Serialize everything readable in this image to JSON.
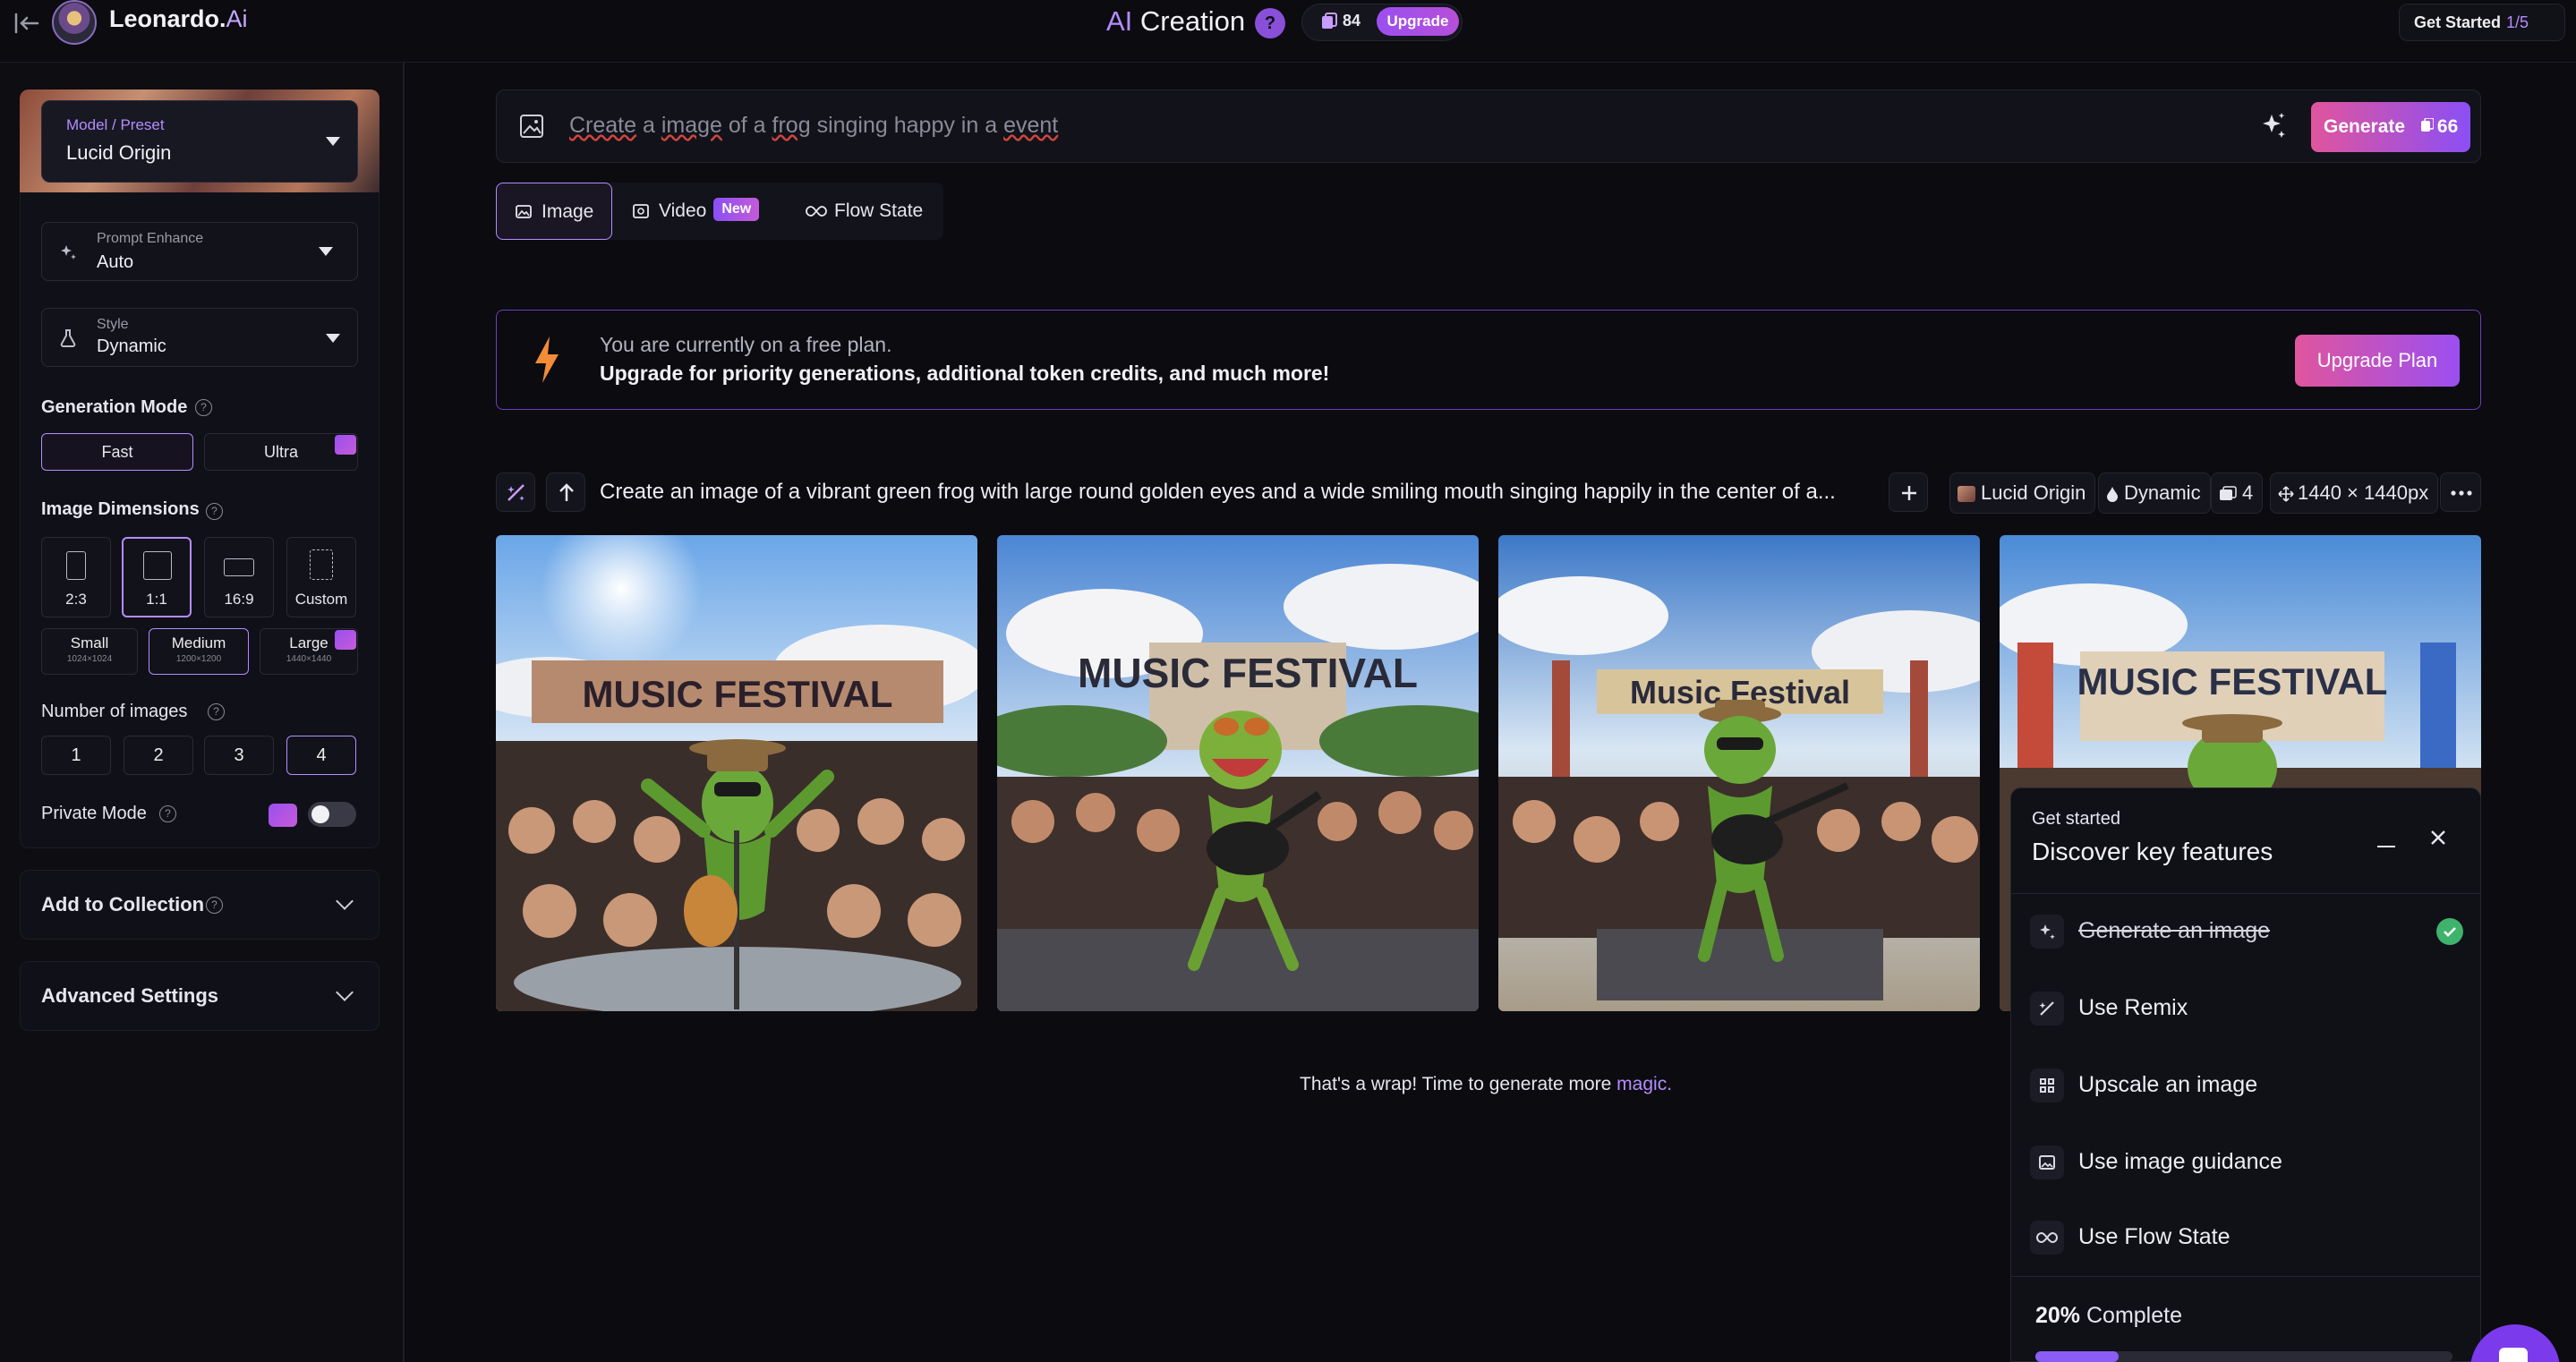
{
  "topbar": {
    "brand_name": "Leonardo.",
    "brand_suffix": "Ai",
    "title_prefix": "AI",
    "title_main": " Creation",
    "help_label": "?",
    "token_count": "84",
    "upgrade_label": "Upgrade",
    "get_started_label": "Get Started",
    "get_started_progress": "1/5"
  },
  "sidebar": {
    "model_label": "Model / Preset",
    "model_value": "Lucid Origin",
    "prompt_enhance_label": "Prompt Enhance",
    "prompt_enhance_value": "Auto",
    "style_label": "Style",
    "style_value": "Dynamic",
    "generation_mode_title": "Generation Mode",
    "generation_modes": [
      "Fast",
      "Ultra"
    ],
    "image_dimensions_title": "Image Dimensions",
    "aspect_ratios": [
      "2:3",
      "1:1",
      "16:9",
      "Custom"
    ],
    "sizes": [
      {
        "name": "Small",
        "dims": "1024×1024"
      },
      {
        "name": "Medium",
        "dims": "1200×1200"
      },
      {
        "name": "Large",
        "dims": "1440×1440"
      }
    ],
    "number_of_images_title": "Number of images",
    "image_counts": [
      "1",
      "2",
      "3",
      "4"
    ],
    "private_mode_label": "Private Mode",
    "add_to_collection_label": "Add to Collection",
    "advanced_settings_label": "Advanced Settings"
  },
  "prompt": {
    "placeholder_parts": [
      "Create",
      " a ",
      "image",
      " of a ",
      "frog",
      " singing happy in a ",
      "event"
    ],
    "generate_label": "Generate",
    "generate_cost": "66"
  },
  "tabs": {
    "image": "Image",
    "video": "Video",
    "video_badge": "New",
    "flow_state": "Flow State"
  },
  "banner": {
    "line1": "You are currently on a free plan.",
    "line2": "Upgrade for priority generations, additional token credits, and much more!",
    "button": "Upgrade Plan"
  },
  "generation": {
    "prompt_text": "Create an image of a vibrant green frog with large round golden eyes and a wide smiling mouth singing happily in the center of a...",
    "model_chip": "Lucid Origin",
    "style_chip": "Dynamic",
    "count_chip": "4",
    "size_chip": "1440 × 1440px",
    "images": [
      {
        "banner": "MUSIC FESTIVAL"
      },
      {
        "banner": "MUSIC FESTIVAL"
      },
      {
        "banner": "Music Festival"
      },
      {
        "banner": "MUSIC FESTIVAL"
      }
    ],
    "wrap_text": "That's a wrap! Time to generate more ",
    "wrap_link": "magic."
  },
  "get_started_panel": {
    "subtitle": "Get started",
    "title": "Discover key features",
    "items": [
      {
        "label": "Generate an image",
        "done": true
      },
      {
        "label": "Use Remix",
        "done": false
      },
      {
        "label": "Upscale an image",
        "done": false
      },
      {
        "label": "Use image guidance",
        "done": false
      },
      {
        "label": "Use Flow State",
        "done": false
      }
    ],
    "progress_percent": "20%",
    "progress_label": " Complete",
    "progress_fraction": 0.2
  },
  "colors": {
    "accent": "#b48cff",
    "generate_gradient_start": "#e0559d",
    "generate_gradient_end": "#8b4ff5",
    "success": "#3fb26b"
  }
}
